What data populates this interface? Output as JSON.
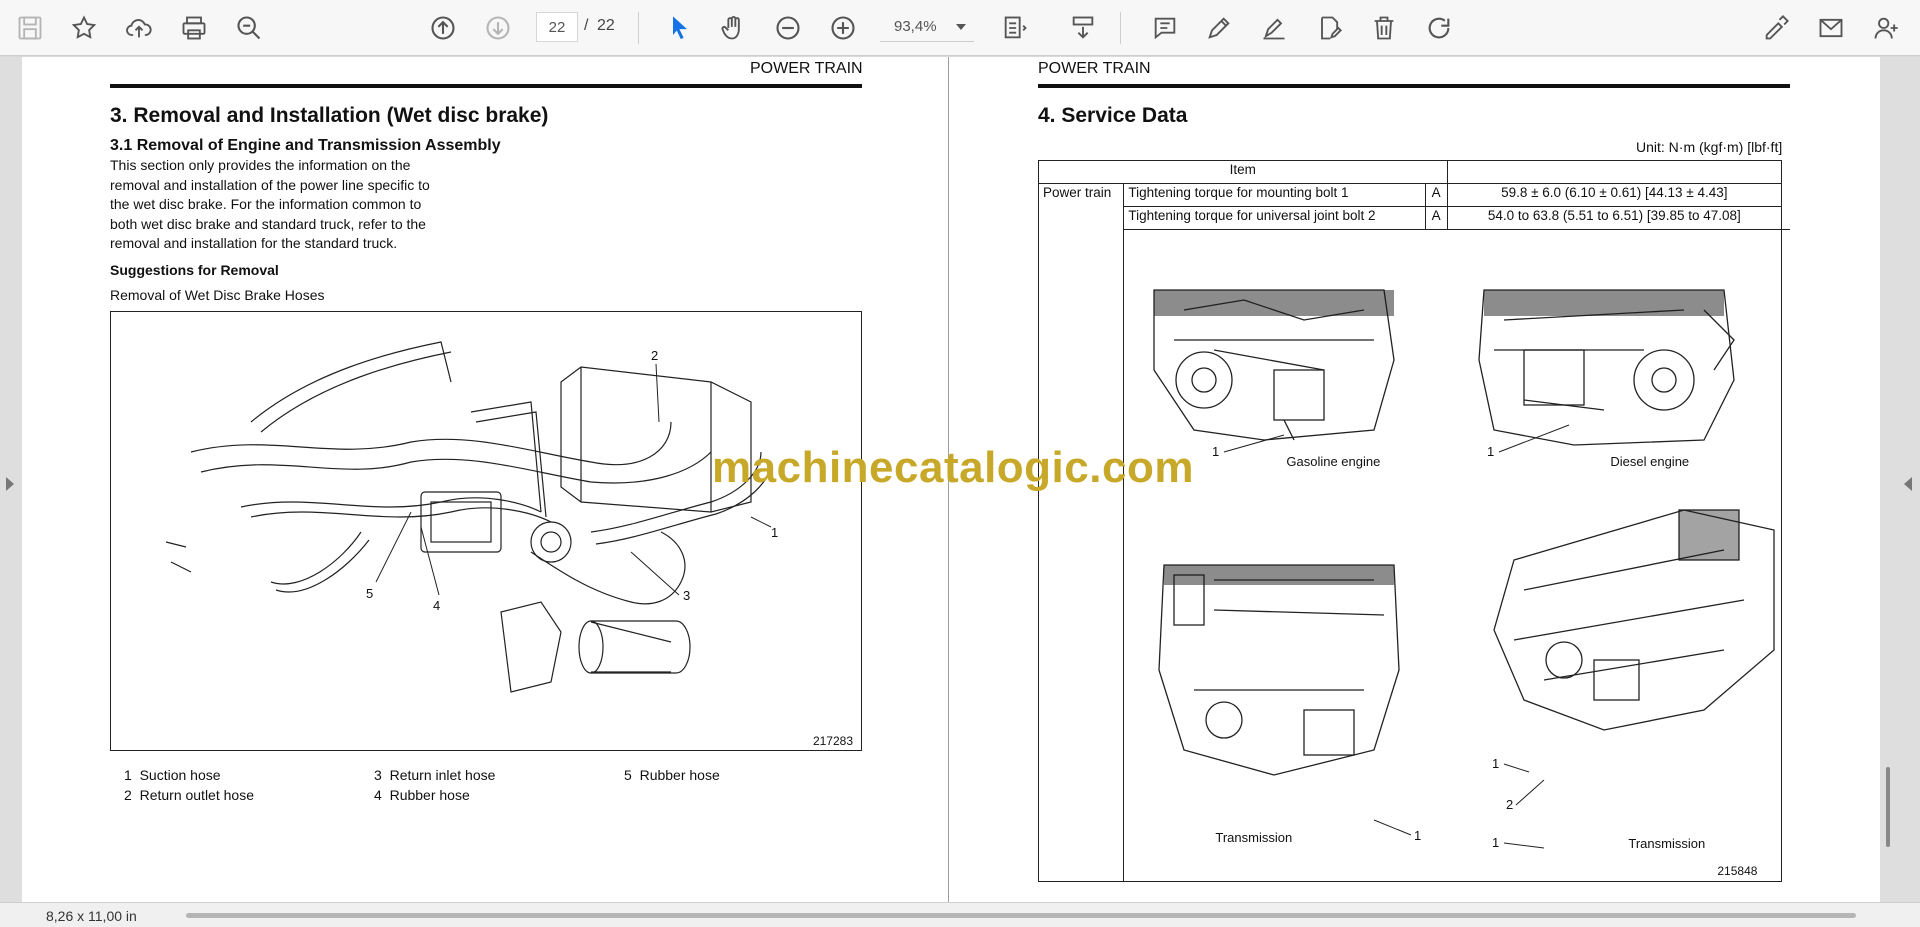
{
  "toolbar": {
    "page_current": "22",
    "page_separator": "/",
    "page_total": "22",
    "zoom": "93,4%",
    "icons": [
      "save-icon",
      "star-icon",
      "cloud-upload-icon",
      "print-icon",
      "zoom-out-search-icon",
      "arrow-up-circle-icon",
      "arrow-down-circle-icon",
      "select-arrow-icon",
      "hand-icon",
      "zoom-out-icon",
      "zoom-in-icon",
      "page-fit-icon",
      "scroll-mode-icon",
      "comment-icon",
      "pencil-icon",
      "sign-icon",
      "edit-pdf-icon",
      "delete-icon",
      "rotate-icon",
      "sign-ribbon-icon",
      "mail-icon",
      "add-user-icon"
    ],
    "accent_color": "#1473e6"
  },
  "left_page": {
    "running_head": "POWER TRAIN",
    "section_title": "3.  Removal and Installation (Wet disc brake)",
    "subsection_title": "3.1   Removal of Engine and Transmission Assembly",
    "intro_lines": [
      "This section only provides the information on the",
      "removal and installation of the power line specific to",
      "the wet disc brake. For the information common to",
      "both wet disc brake and standard truck, refer to the",
      "removal and installation for the standard truck."
    ],
    "suggestions_heading": "Suggestions for Removal",
    "figure_caption": "Removal of Wet Disc Brake Hoses",
    "figure_number": "217283",
    "callouts": [
      "1",
      "2",
      "3",
      "4",
      "5"
    ],
    "legend": [
      {
        "num": "1",
        "label": "Suction hose"
      },
      {
        "num": "2",
        "label": "Return outlet hose"
      },
      {
        "num": "3",
        "label": "Return inlet hose"
      },
      {
        "num": "4",
        "label": "Rubber hose"
      },
      {
        "num": "5",
        "label": "Rubber hose"
      }
    ]
  },
  "right_page": {
    "running_head": "POWER TRAIN",
    "section_title": "4.  Service Data",
    "unit_note": "Unit: N·m (kgf·m) [lbf·ft]",
    "table_header_item": "Item",
    "row_group": "Power train",
    "rows": [
      {
        "item": "Tightening torque for mounting bolt 1",
        "code": "A",
        "value": "59.8 ± 6.0 (6.10 ± 0.61) [44.13 ± 4.43]"
      },
      {
        "item": "Tightening torque for universal joint bolt 2",
        "code": "A",
        "value": "54.0 to 63.8 (5.51 to 6.51) [39.85 to 47.08]"
      }
    ],
    "photo_labels": {
      "gasoline": "Gasoline engine",
      "diesel": "Diesel engine",
      "transmission_left": "Transmission",
      "transmission_right": "Transmission"
    },
    "photo_callouts": {
      "one": "1",
      "two": "2"
    },
    "figure_number": "215848"
  },
  "watermark": "machinecatalogic.com",
  "status": {
    "page_size": "8,26 x 11,00 in"
  }
}
